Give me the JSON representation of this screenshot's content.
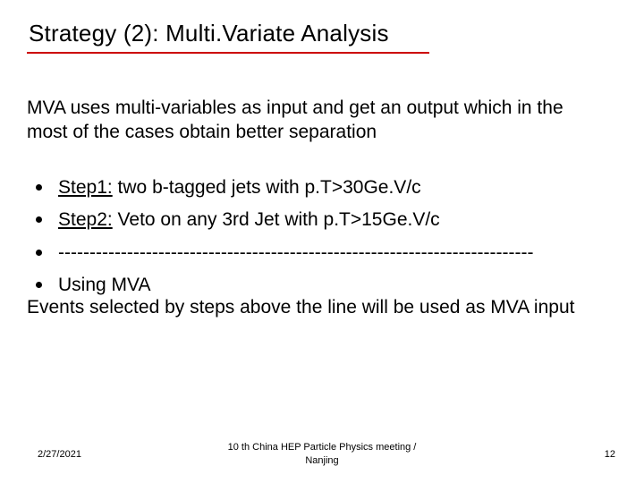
{
  "title": "Strategy (2): Multi.Variate Analysis",
  "intro": "MVA uses multi-variables as input and get an output which in the most of the cases obtain better separation",
  "bullets": [
    {
      "label": "Step1:",
      "rest": " two b-tagged jets with p.T>30Ge.V/c"
    },
    {
      "label": "Step2:",
      "rest": " Veto on any 3rd Jet with p.T>15Ge.V/c"
    },
    {
      "label": "",
      "rest": "----------------------------------------------------------------------------"
    },
    {
      "label": "",
      "rest": "Using MVA"
    }
  ],
  "tail_line": "Events selected by steps above the line will be used as MVA input",
  "footer": {
    "date": "2/27/2021",
    "center_line1": "10 th China HEP Particle Physics meeting /",
    "center_line2": "Nanjing",
    "page": "12"
  }
}
